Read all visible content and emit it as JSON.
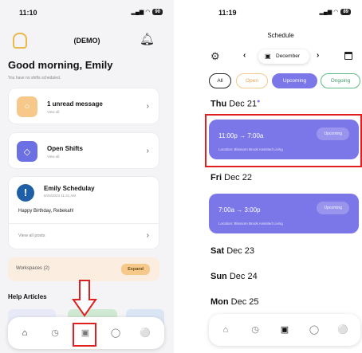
{
  "left": {
    "status_time": "11:10",
    "battery": "90",
    "header_title": "(DEMO)",
    "greeting": "Good morning, Emily",
    "greeting_sub": "You have no shifts scheduled.",
    "messages_card": {
      "title": "1 unread message",
      "sub": "View all",
      "icon": "message-icon"
    },
    "shifts_card": {
      "title": "Open Shifts",
      "sub": "View all",
      "icon": "layers-icon"
    },
    "post_card": {
      "author": "Emily Schedulay",
      "date": "8/26/2023 11:41 AM",
      "body": "Happy Birthday, Rebekah!",
      "link": "View all posts"
    },
    "workspaces": {
      "label": "Workspaces (2)",
      "button": "Expand"
    },
    "help_title": "Help Articles",
    "tabs": [
      "home-icon",
      "clock-icon",
      "calendar-icon",
      "chat-icon",
      "profile-icon"
    ]
  },
  "right": {
    "status_time": "11:19",
    "battery": "89",
    "title": "Schedule",
    "month": "December",
    "filters": [
      "All",
      "Open",
      "Upcoming",
      "Ongoing"
    ],
    "active_filter": "Upcoming",
    "days": [
      {
        "dow": "Thu",
        "date": "Dec 21"
      },
      {
        "dow": "Fri",
        "date": "Dec 22"
      },
      {
        "dow": "Sat",
        "date": "Dec 23"
      },
      {
        "dow": "Sun",
        "date": "Dec 24"
      },
      {
        "dow": "Mon",
        "date": "Dec 25"
      }
    ],
    "shift1": {
      "time": "11:00p → 7:00a",
      "location": "Location: Blossom Brook Assisted Living",
      "status": "Upcoming"
    },
    "shift2": {
      "time": "7:00a → 3:00p",
      "location": "Location: Blossom Brook Assisted Living",
      "status": "Upcoming"
    }
  },
  "colors": {
    "accent": "#7b77e8",
    "highlight": "#e02020",
    "open": "#e9a84f",
    "ongoing": "#3a9c66"
  }
}
